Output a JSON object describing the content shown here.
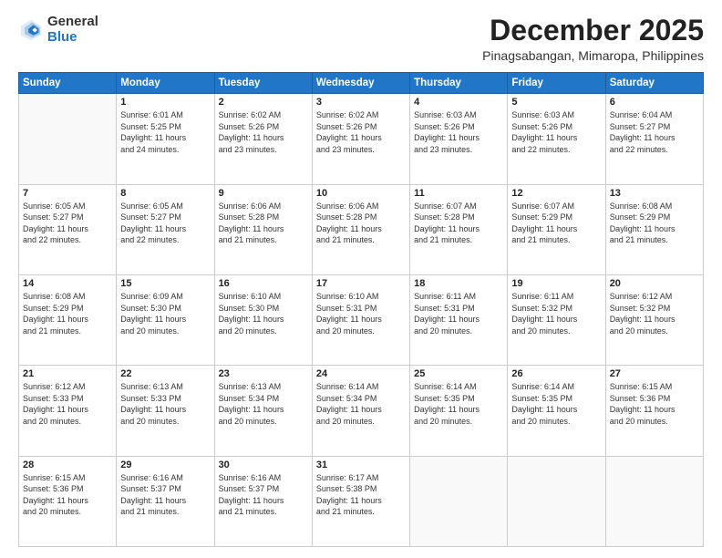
{
  "header": {
    "logo_general": "General",
    "logo_blue": "Blue",
    "month_title": "December 2025",
    "location": "Pinagsabangan, Mimaropa, Philippines"
  },
  "calendar": {
    "days_of_week": [
      "Sunday",
      "Monday",
      "Tuesday",
      "Wednesday",
      "Thursday",
      "Friday",
      "Saturday"
    ],
    "weeks": [
      [
        {
          "day": "",
          "info": ""
        },
        {
          "day": "1",
          "info": "Sunrise: 6:01 AM\nSunset: 5:25 PM\nDaylight: 11 hours\nand 24 minutes."
        },
        {
          "day": "2",
          "info": "Sunrise: 6:02 AM\nSunset: 5:26 PM\nDaylight: 11 hours\nand 23 minutes."
        },
        {
          "day": "3",
          "info": "Sunrise: 6:02 AM\nSunset: 5:26 PM\nDaylight: 11 hours\nand 23 minutes."
        },
        {
          "day": "4",
          "info": "Sunrise: 6:03 AM\nSunset: 5:26 PM\nDaylight: 11 hours\nand 23 minutes."
        },
        {
          "day": "5",
          "info": "Sunrise: 6:03 AM\nSunset: 5:26 PM\nDaylight: 11 hours\nand 22 minutes."
        },
        {
          "day": "6",
          "info": "Sunrise: 6:04 AM\nSunset: 5:27 PM\nDaylight: 11 hours\nand 22 minutes."
        }
      ],
      [
        {
          "day": "7",
          "info": "Sunrise: 6:05 AM\nSunset: 5:27 PM\nDaylight: 11 hours\nand 22 minutes."
        },
        {
          "day": "8",
          "info": "Sunrise: 6:05 AM\nSunset: 5:27 PM\nDaylight: 11 hours\nand 22 minutes."
        },
        {
          "day": "9",
          "info": "Sunrise: 6:06 AM\nSunset: 5:28 PM\nDaylight: 11 hours\nand 21 minutes."
        },
        {
          "day": "10",
          "info": "Sunrise: 6:06 AM\nSunset: 5:28 PM\nDaylight: 11 hours\nand 21 minutes."
        },
        {
          "day": "11",
          "info": "Sunrise: 6:07 AM\nSunset: 5:28 PM\nDaylight: 11 hours\nand 21 minutes."
        },
        {
          "day": "12",
          "info": "Sunrise: 6:07 AM\nSunset: 5:29 PM\nDaylight: 11 hours\nand 21 minutes."
        },
        {
          "day": "13",
          "info": "Sunrise: 6:08 AM\nSunset: 5:29 PM\nDaylight: 11 hours\nand 21 minutes."
        }
      ],
      [
        {
          "day": "14",
          "info": "Sunrise: 6:08 AM\nSunset: 5:29 PM\nDaylight: 11 hours\nand 21 minutes."
        },
        {
          "day": "15",
          "info": "Sunrise: 6:09 AM\nSunset: 5:30 PM\nDaylight: 11 hours\nand 20 minutes."
        },
        {
          "day": "16",
          "info": "Sunrise: 6:10 AM\nSunset: 5:30 PM\nDaylight: 11 hours\nand 20 minutes."
        },
        {
          "day": "17",
          "info": "Sunrise: 6:10 AM\nSunset: 5:31 PM\nDaylight: 11 hours\nand 20 minutes."
        },
        {
          "day": "18",
          "info": "Sunrise: 6:11 AM\nSunset: 5:31 PM\nDaylight: 11 hours\nand 20 minutes."
        },
        {
          "day": "19",
          "info": "Sunrise: 6:11 AM\nSunset: 5:32 PM\nDaylight: 11 hours\nand 20 minutes."
        },
        {
          "day": "20",
          "info": "Sunrise: 6:12 AM\nSunset: 5:32 PM\nDaylight: 11 hours\nand 20 minutes."
        }
      ],
      [
        {
          "day": "21",
          "info": "Sunrise: 6:12 AM\nSunset: 5:33 PM\nDaylight: 11 hours\nand 20 minutes."
        },
        {
          "day": "22",
          "info": "Sunrise: 6:13 AM\nSunset: 5:33 PM\nDaylight: 11 hours\nand 20 minutes."
        },
        {
          "day": "23",
          "info": "Sunrise: 6:13 AM\nSunset: 5:34 PM\nDaylight: 11 hours\nand 20 minutes."
        },
        {
          "day": "24",
          "info": "Sunrise: 6:14 AM\nSunset: 5:34 PM\nDaylight: 11 hours\nand 20 minutes."
        },
        {
          "day": "25",
          "info": "Sunrise: 6:14 AM\nSunset: 5:35 PM\nDaylight: 11 hours\nand 20 minutes."
        },
        {
          "day": "26",
          "info": "Sunrise: 6:14 AM\nSunset: 5:35 PM\nDaylight: 11 hours\nand 20 minutes."
        },
        {
          "day": "27",
          "info": "Sunrise: 6:15 AM\nSunset: 5:36 PM\nDaylight: 11 hours\nand 20 minutes."
        }
      ],
      [
        {
          "day": "28",
          "info": "Sunrise: 6:15 AM\nSunset: 5:36 PM\nDaylight: 11 hours\nand 20 minutes."
        },
        {
          "day": "29",
          "info": "Sunrise: 6:16 AM\nSunset: 5:37 PM\nDaylight: 11 hours\nand 21 minutes."
        },
        {
          "day": "30",
          "info": "Sunrise: 6:16 AM\nSunset: 5:37 PM\nDaylight: 11 hours\nand 21 minutes."
        },
        {
          "day": "31",
          "info": "Sunrise: 6:17 AM\nSunset: 5:38 PM\nDaylight: 11 hours\nand 21 minutes."
        },
        {
          "day": "",
          "info": ""
        },
        {
          "day": "",
          "info": ""
        },
        {
          "day": "",
          "info": ""
        }
      ]
    ]
  }
}
